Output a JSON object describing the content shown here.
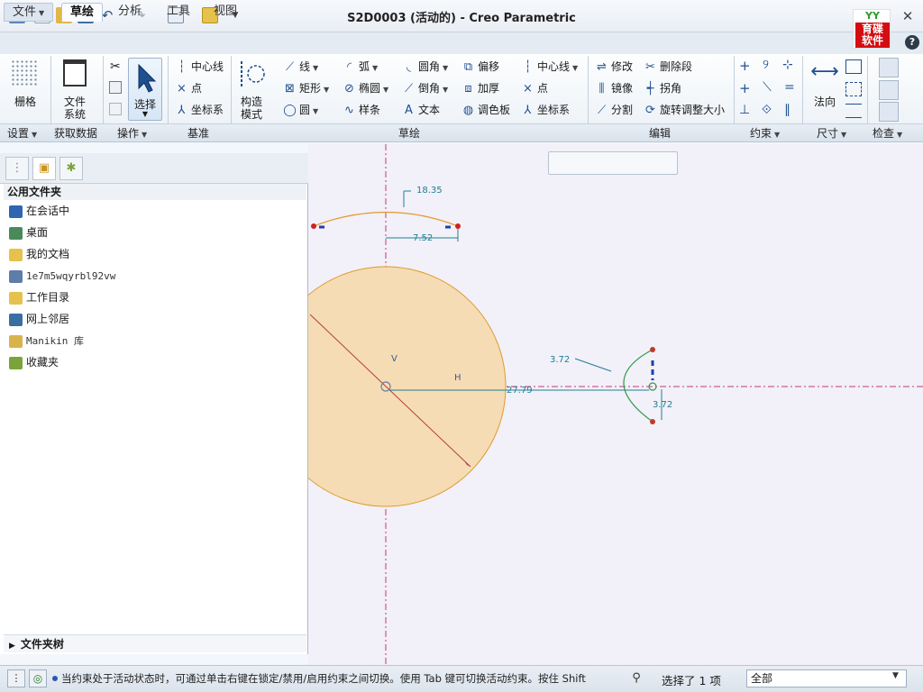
{
  "window": {
    "title": "S2D0003 (活动的) - Creo Parametric"
  },
  "logo": {
    "line1": "YY",
    "line2": "育碟",
    "line3": "软件"
  },
  "menu_tabs": [
    "文件",
    "草绘",
    "分析",
    "工具",
    "视图"
  ],
  "ribbon": {
    "settings": {
      "grid": "栅格"
    },
    "getdata": {
      "filesys_l1": "文件",
      "filesys_l2": "系统"
    },
    "operations": {
      "select": "选择"
    },
    "datum": {
      "centerline": "中心线",
      "point": "点",
      "coordsys": "坐标系"
    },
    "construct": {
      "l1": "构造",
      "l2": "模式"
    },
    "sketch": {
      "line": "线",
      "rectangle": "矩形",
      "circle": "圆",
      "arc": "弧",
      "ellipse": "椭圆",
      "spline": "样条",
      "fillet": "圆角",
      "chamfer": "倒角",
      "text": "文本",
      "offset": "偏移",
      "thicken": "加厚",
      "palette": "调色板",
      "centerline": "中心线",
      "point": "点",
      "coordsys": "坐标系"
    },
    "edit": {
      "modify": "修改",
      "delete_segment": "删除段",
      "mirror": "镜像",
      "corner": "拐角",
      "divide": "分割",
      "rotate_resize": "旋转调整大小"
    },
    "dimension": {
      "normal": "法向"
    },
    "groups": {
      "settings": "设置",
      "getdata": "获取数据",
      "operations": "操作",
      "datum": "基准",
      "sketch": "草绘",
      "edit": "编辑",
      "constrain": "约束",
      "dimension": "尺寸",
      "inspect": "检查"
    }
  },
  "folder_panel": {
    "header": "公用文件夹",
    "items": [
      "在会话中",
      "桌面",
      "我的文档",
      "1e7m5wqyrbl92vw",
      "工作目录",
      "网上邻居",
      "Manikin 库",
      "收藏夹"
    ],
    "tree_label": "文件夹树"
  },
  "sketch": {
    "dims": {
      "arc_length": "18.35",
      "arc_half": "7.52",
      "horiz": "27.79",
      "r_top": "3.72",
      "r_bottom": "3.72"
    },
    "labels": {
      "v": "V",
      "h": "H"
    }
  },
  "status": {
    "message": "当约束处于活动状态时，可通过单击右键在锁定/禁用/启用约束之间切换。使用 Tab 键可切换活动约束。按住 Shift",
    "selected": "选择了 1 项",
    "filter": "全部"
  },
  "colors": {
    "accent": "#2f66b3",
    "sketch_fill": "#f5dcb4",
    "sketch_stroke": "#e09a2a",
    "dim": "#1f7f95",
    "axis": "#c23a7a"
  }
}
